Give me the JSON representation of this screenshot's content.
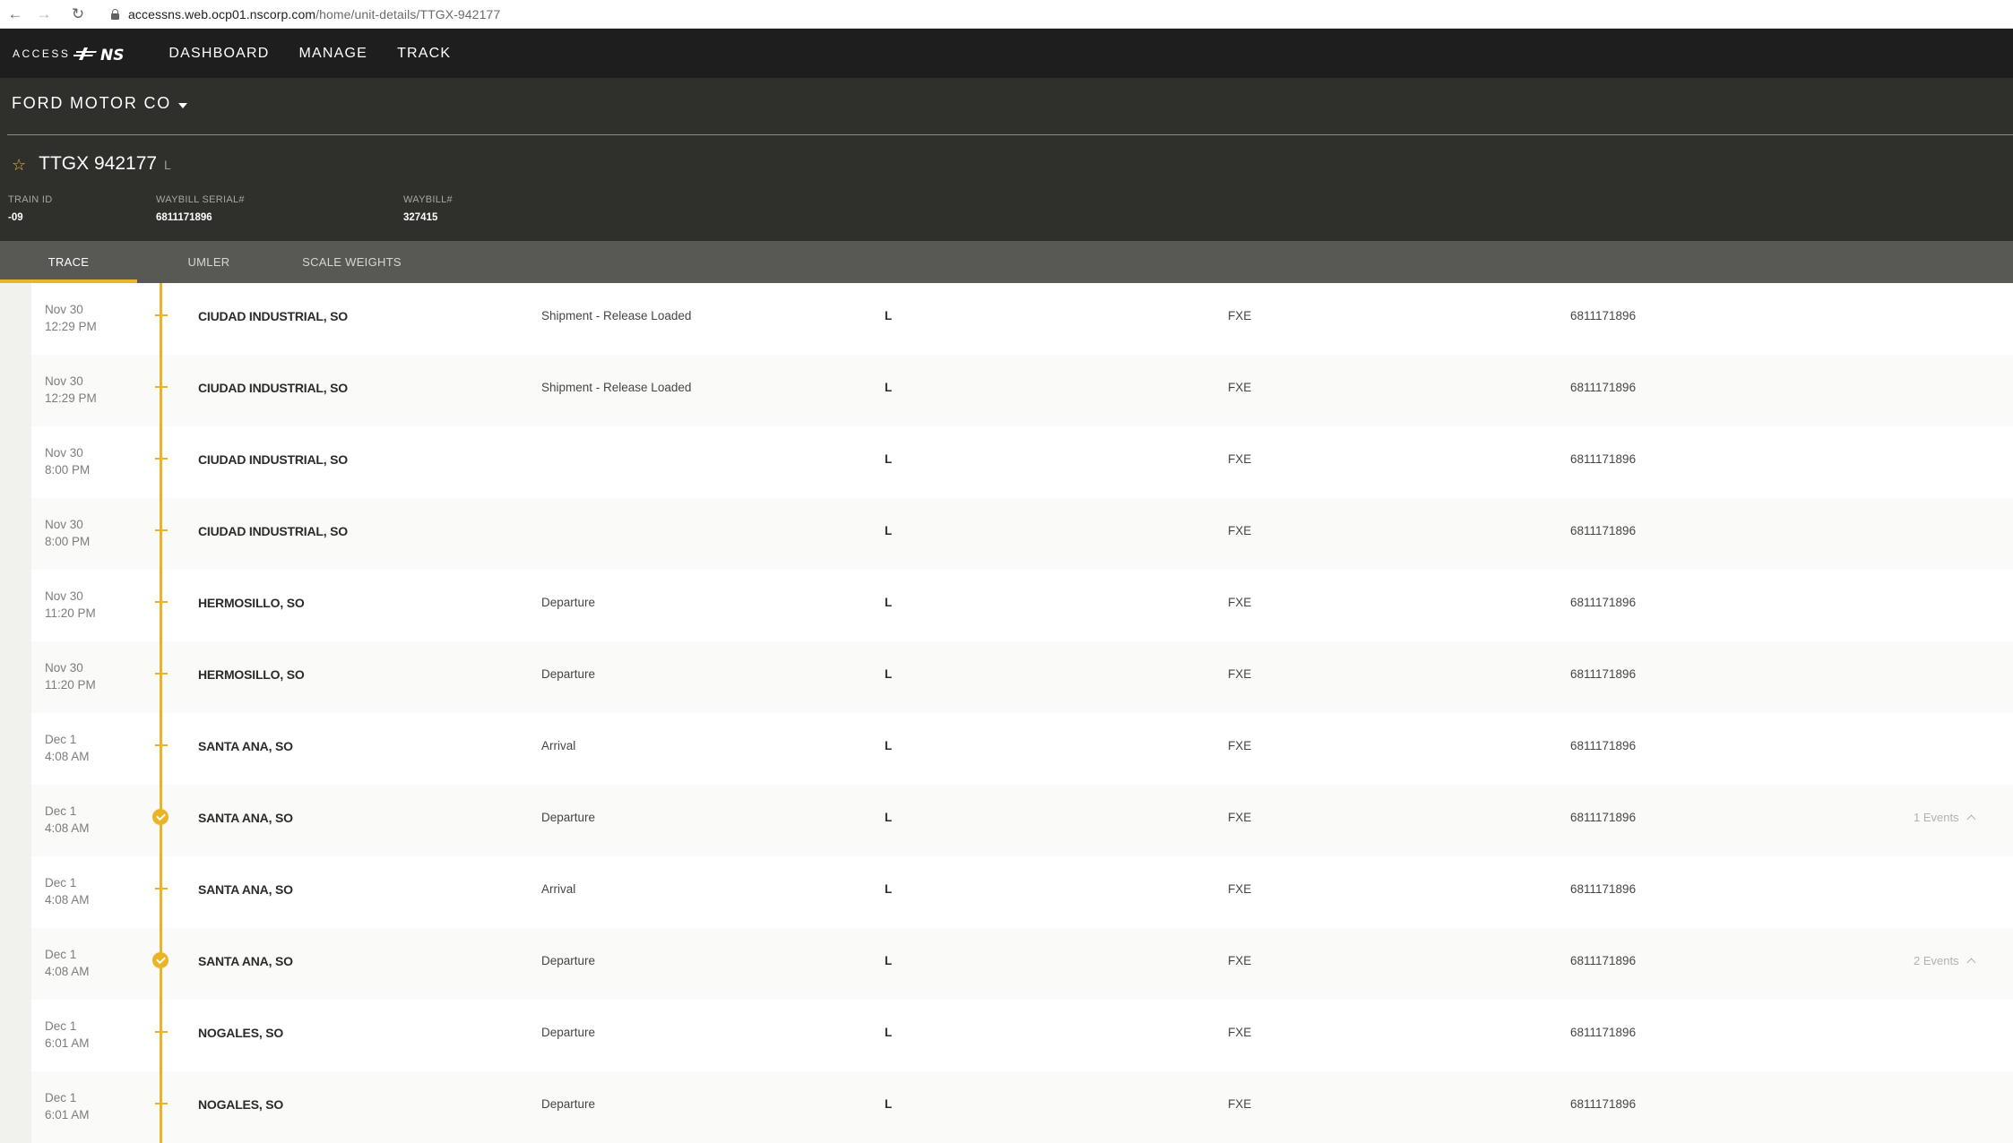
{
  "browser": {
    "url_host": "accessns.web.ocp01.nscorp.com",
    "url_path": "/home/unit-details/TTGX-942177"
  },
  "app": {
    "logo_text": "ACCESS",
    "logo_mark": "NS",
    "nav": [
      "DASHBOARD",
      "MANAGE",
      "TRACK"
    ]
  },
  "context": {
    "company": "FORD MOTOR CO",
    "unit_id": "TTGX 942177",
    "unit_status": "L",
    "fields": [
      {
        "label": "TRAIN ID",
        "value": "-09"
      },
      {
        "label": "WAYBILL SERIAL#",
        "value": "6811171896"
      },
      {
        "label": "WAYBILL#",
        "value": "327415"
      }
    ]
  },
  "tabs": [
    "TRACE",
    "UMLER",
    "SCALE WEIGHTS"
  ],
  "active_tab": "TRACE",
  "colors": {
    "accent": "#e9b425",
    "header": "#1e1e1e",
    "context": "#2f2f2b",
    "tabbar": "#585855"
  },
  "rows": [
    {
      "date": "Nov 30",
      "time": "12:29 PM",
      "location": "CIUDAD INDUSTRIAL, SO",
      "event": "Shipment - Release Loaded",
      "status": "L",
      "road": "FXE",
      "waybill": "6811171896",
      "events": "",
      "marker": "tick"
    },
    {
      "date": "Nov 30",
      "time": "12:29 PM",
      "location": "CIUDAD INDUSTRIAL, SO",
      "event": "Shipment - Release Loaded",
      "status": "L",
      "road": "FXE",
      "waybill": "6811171896",
      "events": "",
      "marker": "tick"
    },
    {
      "date": "Nov 30",
      "time": "8:00 PM",
      "location": "CIUDAD INDUSTRIAL, SO",
      "event": "",
      "status": "L",
      "road": "FXE",
      "waybill": "6811171896",
      "events": "",
      "marker": "tick"
    },
    {
      "date": "Nov 30",
      "time": "8:00 PM",
      "location": "CIUDAD INDUSTRIAL, SO",
      "event": "",
      "status": "L",
      "road": "FXE",
      "waybill": "6811171896",
      "events": "",
      "marker": "tick"
    },
    {
      "date": "Nov 30",
      "time": "11:20 PM",
      "location": "HERMOSILLO, SO",
      "event": "Departure",
      "status": "L",
      "road": "FXE",
      "waybill": "6811171896",
      "events": "",
      "marker": "tick"
    },
    {
      "date": "Nov 30",
      "time": "11:20 PM",
      "location": "HERMOSILLO, SO",
      "event": "Departure",
      "status": "L",
      "road": "FXE",
      "waybill": "6811171896",
      "events": "",
      "marker": "tick"
    },
    {
      "date": "Dec 1",
      "time": "4:08 AM",
      "location": "SANTA ANA, SO",
      "event": "Arrival",
      "status": "L",
      "road": "FXE",
      "waybill": "6811171896",
      "events": "",
      "marker": "tick"
    },
    {
      "date": "Dec 1",
      "time": "4:08 AM",
      "location": "SANTA ANA, SO",
      "event": "Departure",
      "status": "L",
      "road": "FXE",
      "waybill": "6811171896",
      "events": "1 Events",
      "marker": "check"
    },
    {
      "date": "Dec 1",
      "time": "4:08 AM",
      "location": "SANTA ANA, SO",
      "event": "Arrival",
      "status": "L",
      "road": "FXE",
      "waybill": "6811171896",
      "events": "",
      "marker": "tick"
    },
    {
      "date": "Dec 1",
      "time": "4:08 AM",
      "location": "SANTA ANA, SO",
      "event": "Departure",
      "status": "L",
      "road": "FXE",
      "waybill": "6811171896",
      "events": "2 Events",
      "marker": "check"
    },
    {
      "date": "Dec 1",
      "time": "6:01 AM",
      "location": "NOGALES, SO",
      "event": "Departure",
      "status": "L",
      "road": "FXE",
      "waybill": "6811171896",
      "events": "",
      "marker": "tick"
    },
    {
      "date": "Dec 1",
      "time": "6:01 AM",
      "location": "NOGALES, SO",
      "event": "Departure",
      "status": "L",
      "road": "FXE",
      "waybill": "6811171896",
      "events": "",
      "marker": "tick"
    }
  ]
}
